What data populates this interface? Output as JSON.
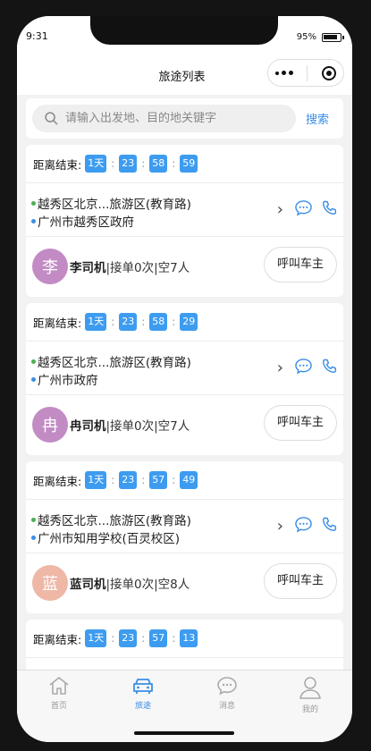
{
  "status": {
    "time": "9:31",
    "battery": "95%"
  },
  "navbar": {
    "title": "旅途列表"
  },
  "search": {
    "placeholder": "请输入出发地、目的地关键字",
    "button_label": "搜索"
  },
  "countdown_label": "距离结束:",
  "call_label": "呼叫车主",
  "trips": [
    {
      "countdown": {
        "days": "1天",
        "hours": "23",
        "minutes": "58",
        "seconds": "59"
      },
      "from": "越秀区北京...旅游区(教育路)",
      "to": "广州市越秀区政府",
      "driver": {
        "avatar_char": "李",
        "avatar_color": "#c28bc4",
        "name": "李司机",
        "info": "|接单0次|空7人"
      }
    },
    {
      "countdown": {
        "days": "1天",
        "hours": "23",
        "minutes": "58",
        "seconds": "29"
      },
      "from": "越秀区北京...旅游区(教育路)",
      "to": "广州市政府",
      "driver": {
        "avatar_char": "冉",
        "avatar_color": "#c28bc4",
        "name": "冉司机",
        "info": "|接单0次|空7人"
      }
    },
    {
      "countdown": {
        "days": "1天",
        "hours": "23",
        "minutes": "57",
        "seconds": "49"
      },
      "from": "越秀区北京...旅游区(教育路)",
      "to": "广州市知用学校(百灵校区)",
      "driver": {
        "avatar_char": "蓝",
        "avatar_color": "#efb7a6",
        "name": "蓝司机",
        "info": "|接单0次|空8人"
      }
    },
    {
      "countdown": {
        "days": "1天",
        "hours": "23",
        "minutes": "57",
        "seconds": "13"
      }
    }
  ],
  "tabbar": {
    "items": [
      {
        "label": "首页",
        "icon": "home-icon"
      },
      {
        "label": "旅途",
        "icon": "car-icon"
      },
      {
        "label": "消息",
        "icon": "message-icon"
      },
      {
        "label": "我的",
        "icon": "user-icon"
      }
    ],
    "active_index": 1,
    "active_color": "#3a8ee6"
  }
}
